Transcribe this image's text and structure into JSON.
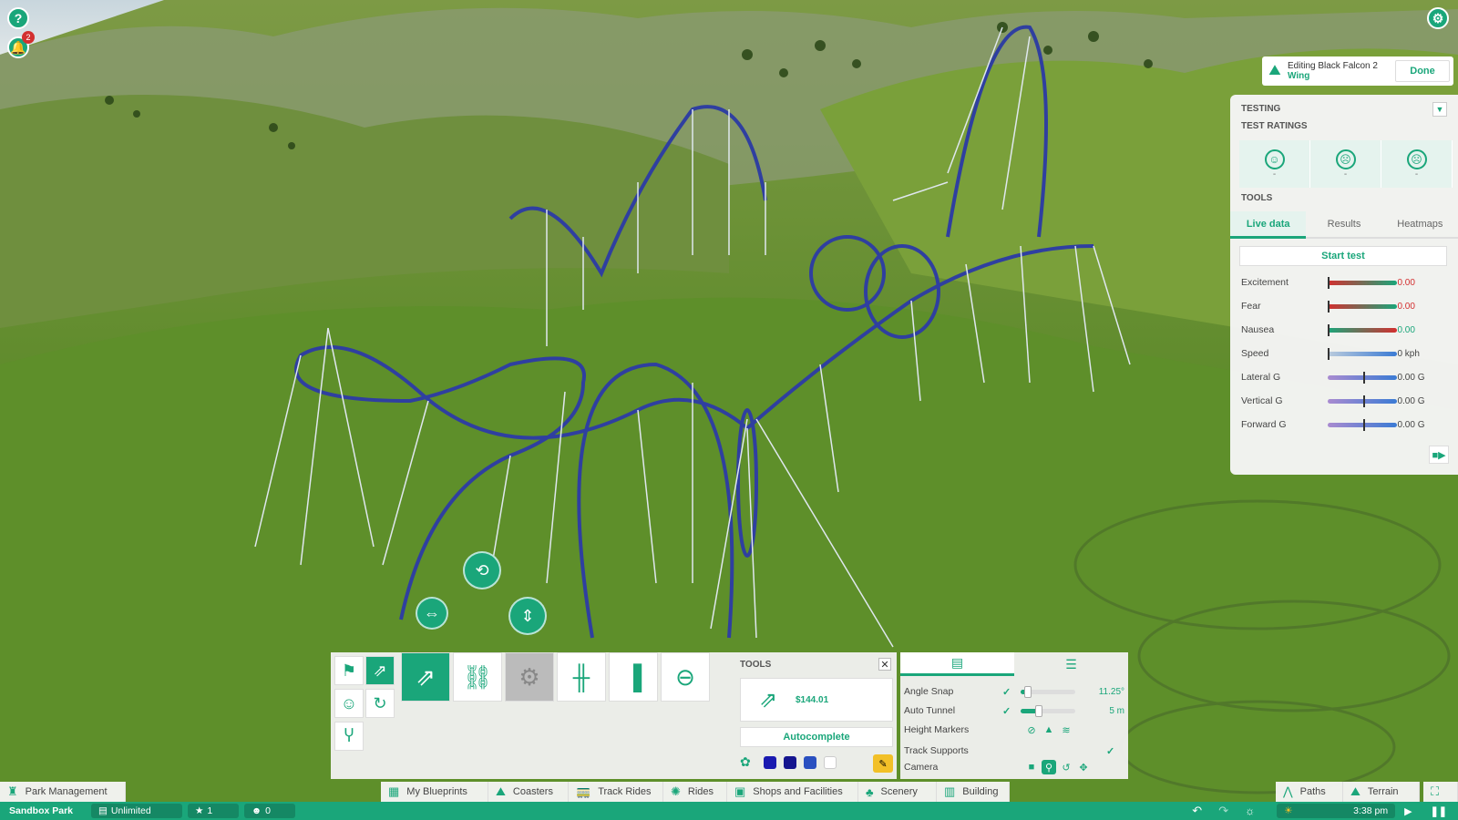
{
  "top_left": {
    "help_label": "?",
    "notification_count": "2"
  },
  "editing": {
    "line1": "Editing Black Falcon 2",
    "line2": "Wing",
    "done_label": "Done"
  },
  "testing": {
    "title": "TESTING",
    "ratings_title": "TEST RATINGS",
    "ratings": [
      {
        "face": "☺",
        "value": "-"
      },
      {
        "face": "☹",
        "value": "-"
      },
      {
        "face": "☹",
        "value": "-"
      }
    ],
    "tools_title": "TOOLS",
    "tabs": [
      "Live data",
      "Results",
      "Heatmaps"
    ],
    "start_label": "Start test",
    "stats": [
      {
        "label": "Excitement",
        "value": "0.00",
        "bar": "rg",
        "marker": 0.0,
        "color": "#d32f2f"
      },
      {
        "label": "Fear",
        "value": "0.00",
        "bar": "rg",
        "marker": 0.0,
        "color": "#d32f2f"
      },
      {
        "label": "Nausea",
        "value": "0.00",
        "bar": "gr",
        "marker": 0.0,
        "color": "#1aa67a"
      },
      {
        "label": "Speed",
        "value": "0 kph",
        "bar": "blue",
        "marker": 0.0,
        "color": "#444"
      },
      {
        "label": "Lateral G",
        "value": "0.00 G",
        "bar": "pb",
        "marker": 0.5,
        "color": "#444"
      },
      {
        "label": "Vertical G",
        "value": "0.00 G",
        "bar": "pb",
        "marker": 0.5,
        "color": "#444"
      },
      {
        "label": "Forward G",
        "value": "0.00 G",
        "bar": "pb",
        "marker": 0.5,
        "color": "#444"
      }
    ]
  },
  "tools": {
    "title": "TOOLS",
    "cost": "$144.01",
    "autocomplete_label": "Autocomplete",
    "swatches": [
      "#1a1ab0",
      "#15158f",
      "#2a50c0",
      "#ffffff"
    ]
  },
  "settings": {
    "rows": [
      {
        "label": "Angle Snap",
        "value": "11.25°",
        "fraction": 0.1
      },
      {
        "label": "Auto Tunnel",
        "value": "5 m",
        "fraction": 0.3
      }
    ],
    "height_markers_label": "Height Markers",
    "track_supports_label": "Track Supports",
    "camera_label": "Camera"
  },
  "menu": {
    "park_management": "Park Management",
    "blueprints": "My Blueprints",
    "coasters": "Coasters",
    "track_rides": "Track Rides",
    "rides": "Rides",
    "shops": "Shops and Facilities",
    "scenery": "Scenery",
    "building": "Building",
    "paths": "Paths",
    "terrain": "Terrain"
  },
  "status": {
    "park": "Sandbox Park",
    "money": "Unlimited",
    "rating": "1",
    "guests": "0",
    "time": "3:38 pm"
  }
}
